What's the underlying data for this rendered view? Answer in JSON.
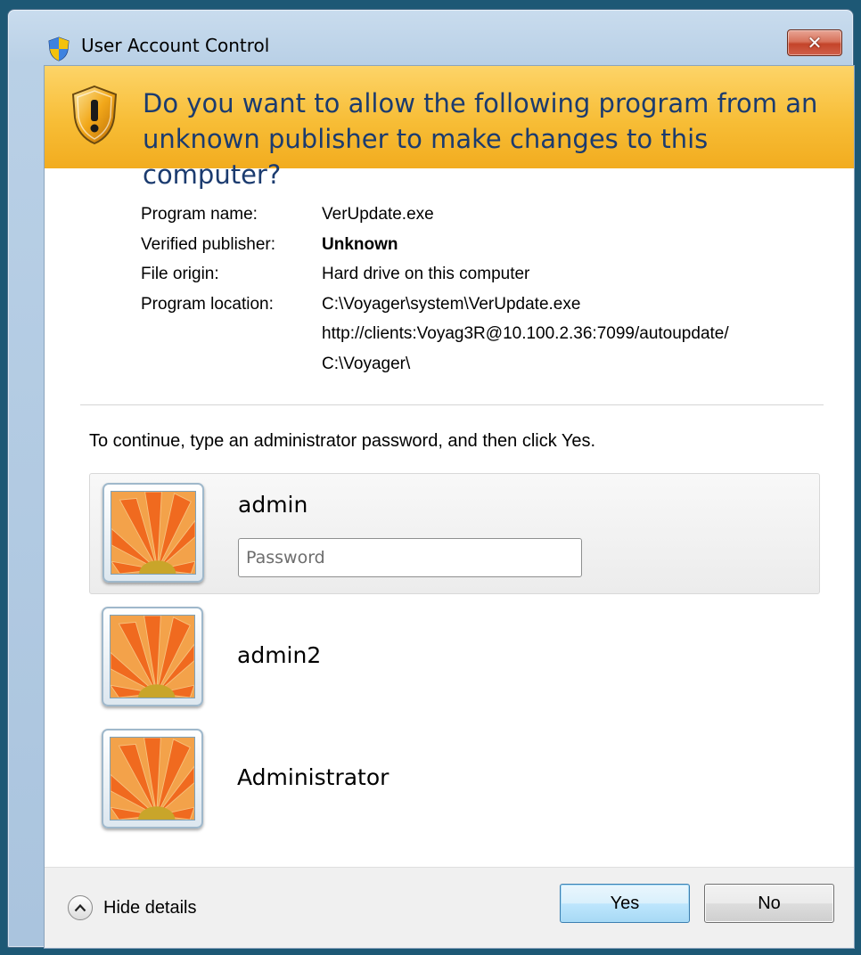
{
  "window": {
    "title": "User Account Control",
    "close_label": "✕"
  },
  "banner": {
    "heading": "Do you want to allow the following program from an unknown publisher to make changes to this computer?"
  },
  "details": {
    "rows": [
      {
        "label": "Program name:",
        "value": "VerUpdate.exe",
        "bold": false
      },
      {
        "label": "Verified publisher:",
        "value": "Unknown",
        "bold": true
      },
      {
        "label": "File origin:",
        "value": "Hard drive on this computer",
        "bold": false
      },
      {
        "label": "Program location:",
        "value": "C:\\Voyager\\system\\VerUpdate.exe",
        "bold": false
      },
      {
        "label": "",
        "value": "http://clients:Voyag3R@10.100.2.36:7099/autoupdate/",
        "bold": false
      },
      {
        "label": "",
        "value": "C:\\Voyager\\",
        "bold": false
      }
    ]
  },
  "instructions": "To continue, type an administrator password, and then click Yes.",
  "accounts": [
    {
      "name": "admin",
      "password_placeholder": "Password"
    },
    {
      "name": "admin2"
    },
    {
      "name": "Administrator"
    }
  ],
  "footer": {
    "toggle_label": "Hide details",
    "yes_label": "Yes",
    "no_label": "No"
  },
  "colors": {
    "banner": "#f7bd36",
    "heading_text": "#1b3b6f",
    "desktop": "#1d5875"
  }
}
